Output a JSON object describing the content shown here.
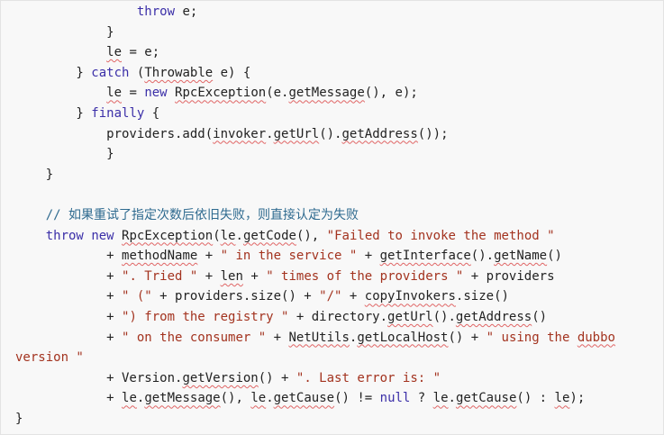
{
  "colors": {
    "background": "#f8f8f8",
    "border": "#e3e3e3",
    "text": "#222222",
    "keyword": "#3b2fa8",
    "string": "#a3331f",
    "comment": "#2e6a8f",
    "spellcheck_underline": "#e06565"
  },
  "code": {
    "lines": [
      {
        "tokens": [
          {
            "t": "                "
          },
          {
            "t": "throw",
            "k": "kw"
          },
          {
            "t": " e;"
          }
        ]
      },
      {
        "tokens": [
          {
            "t": "            }"
          }
        ]
      },
      {
        "tokens": [
          {
            "t": "            "
          },
          {
            "t": "le",
            "k": "sq"
          },
          {
            "t": " = e;"
          }
        ]
      },
      {
        "tokens": [
          {
            "t": "        } "
          },
          {
            "t": "catch",
            "k": "kw"
          },
          {
            "t": " ("
          },
          {
            "t": "Throwable",
            "k": "sq"
          },
          {
            "t": " e) {"
          }
        ]
      },
      {
        "tokens": [
          {
            "t": "            "
          },
          {
            "t": "le",
            "k": "sq"
          },
          {
            "t": " = "
          },
          {
            "t": "new",
            "k": "kw"
          },
          {
            "t": " "
          },
          {
            "t": "RpcException",
            "k": "sq"
          },
          {
            "t": "(e."
          },
          {
            "t": "getMessage",
            "k": "sq"
          },
          {
            "t": "(), e);"
          }
        ]
      },
      {
        "tokens": [
          {
            "t": "        } "
          },
          {
            "t": "finally",
            "k": "kw"
          },
          {
            "t": " {"
          }
        ]
      },
      {
        "tokens": [
          {
            "t": "            providers.add("
          },
          {
            "t": "invoker",
            "k": "sq"
          },
          {
            "t": "."
          },
          {
            "t": "getUrl",
            "k": "sq"
          },
          {
            "t": "()."
          },
          {
            "t": "getAddress",
            "k": "sq"
          },
          {
            "t": "());"
          }
        ]
      },
      {
        "tokens": [
          {
            "t": "            }"
          }
        ]
      },
      {
        "tokens": [
          {
            "t": "    }"
          }
        ]
      },
      {
        "tokens": [
          {
            "t": ""
          }
        ]
      },
      {
        "tokens": [
          {
            "t": "    "
          },
          {
            "t": "// 如果重试了指定次数后依旧失败，则直接认定为失败",
            "k": "cm"
          }
        ]
      },
      {
        "tokens": [
          {
            "t": "    "
          },
          {
            "t": "throw",
            "k": "kw"
          },
          {
            "t": " "
          },
          {
            "t": "new",
            "k": "kw"
          },
          {
            "t": " "
          },
          {
            "t": "RpcException",
            "k": "sq"
          },
          {
            "t": "("
          },
          {
            "t": "le",
            "k": "sq"
          },
          {
            "t": "."
          },
          {
            "t": "getCode",
            "k": "sq"
          },
          {
            "t": "(), "
          },
          {
            "t": "\"Failed to invoke the method \"",
            "k": "str"
          }
        ]
      },
      {
        "tokens": [
          {
            "t": "            + "
          },
          {
            "t": "methodName",
            "k": "sq"
          },
          {
            "t": " + "
          },
          {
            "t": "\" in the service \"",
            "k": "str"
          },
          {
            "t": " + "
          },
          {
            "t": "getInterface",
            "k": "sq"
          },
          {
            "t": "()."
          },
          {
            "t": "getName",
            "k": "sq"
          },
          {
            "t": "()"
          }
        ]
      },
      {
        "tokens": [
          {
            "t": "            + "
          },
          {
            "t": "\". Tried \"",
            "k": "str"
          },
          {
            "t": " + "
          },
          {
            "t": "len",
            "k": "sq"
          },
          {
            "t": " + "
          },
          {
            "t": "\" times of the providers \"",
            "k": "str"
          },
          {
            "t": " + providers"
          }
        ]
      },
      {
        "tokens": [
          {
            "t": "            + "
          },
          {
            "t": "\" (\"",
            "k": "str"
          },
          {
            "t": " + providers.size() + "
          },
          {
            "t": "\"/\"",
            "k": "str"
          },
          {
            "t": " + "
          },
          {
            "t": "copyInvokers",
            "k": "sq"
          },
          {
            "t": ".size()"
          }
        ]
      },
      {
        "tokens": [
          {
            "t": "            + "
          },
          {
            "t": "\") from the registry \"",
            "k": "str"
          },
          {
            "t": " + directory."
          },
          {
            "t": "getUrl",
            "k": "sq"
          },
          {
            "t": "()."
          },
          {
            "t": "getAddress",
            "k": "sq"
          },
          {
            "t": "()"
          }
        ]
      },
      {
        "tokens": [
          {
            "t": "            + "
          },
          {
            "t": "\" on the consumer \"",
            "k": "str"
          },
          {
            "t": " + "
          },
          {
            "t": "NetUtils",
            "k": "sq"
          },
          {
            "t": "."
          },
          {
            "t": "getLocalHost",
            "k": "sq"
          },
          {
            "t": "() + "
          },
          {
            "t": "\" using the ",
            "k": "str"
          },
          {
            "t": "dubbo",
            "k": "str sq"
          }
        ]
      },
      {
        "tokens": [
          {
            "t": "version \"",
            "k": "str"
          }
        ]
      },
      {
        "tokens": [
          {
            "t": "            + Version."
          },
          {
            "t": "getVersion",
            "k": "sq"
          },
          {
            "t": "() + "
          },
          {
            "t": "\". Last error is: \"",
            "k": "str"
          }
        ]
      },
      {
        "tokens": [
          {
            "t": "            + "
          },
          {
            "t": "le",
            "k": "sq"
          },
          {
            "t": "."
          },
          {
            "t": "getMessage",
            "k": "sq"
          },
          {
            "t": "(), "
          },
          {
            "t": "le",
            "k": "sq"
          },
          {
            "t": "."
          },
          {
            "t": "getCause",
            "k": "sq"
          },
          {
            "t": "() != "
          },
          {
            "t": "null",
            "k": "kw"
          },
          {
            "t": " ? "
          },
          {
            "t": "le",
            "k": "sq"
          },
          {
            "t": "."
          },
          {
            "t": "getCause",
            "k": "sq"
          },
          {
            "t": "() : "
          },
          {
            "t": "le",
            "k": "sq"
          },
          {
            "t": ");"
          }
        ]
      },
      {
        "tokens": [
          {
            "t": "}"
          }
        ]
      }
    ]
  }
}
